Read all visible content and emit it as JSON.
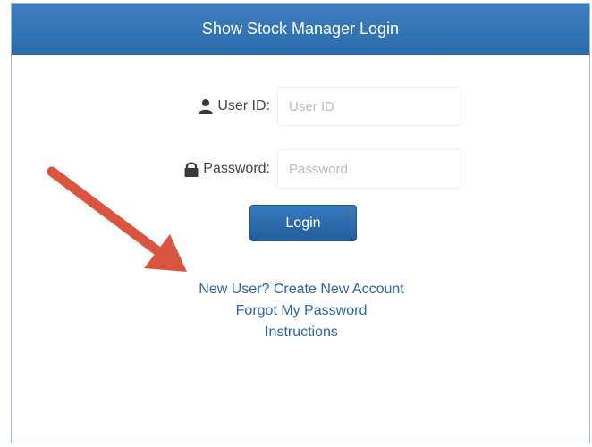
{
  "header": {
    "title": "Show Stock Manager Login"
  },
  "form": {
    "userid": {
      "label": "User ID:",
      "placeholder": "User ID",
      "icon": "user-icon"
    },
    "password": {
      "label": "Password:",
      "placeholder": "Password",
      "icon": "lock-icon"
    },
    "login_label": "Login"
  },
  "links": {
    "create_account": "New User? Create New Account",
    "forgot_password": "Forgot My Password",
    "instructions": "Instructions"
  },
  "colors": {
    "header_bg": "#2f70b2",
    "link": "#2a66a8",
    "arrow": "#d9553f"
  }
}
